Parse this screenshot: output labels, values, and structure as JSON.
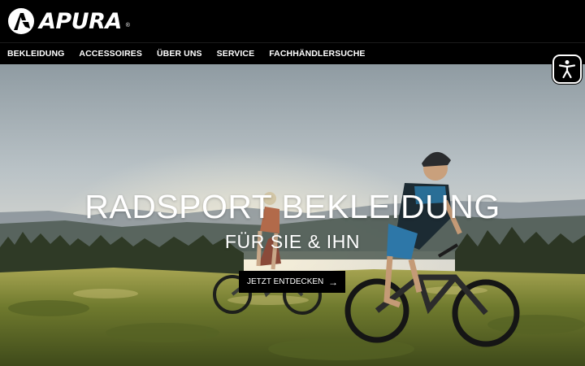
{
  "brand": {
    "name": "APURA",
    "registered_mark": "®"
  },
  "nav": {
    "items": [
      {
        "label": "BEKLEIDUNG"
      },
      {
        "label": "ACCESSOIRES"
      },
      {
        "label": "ÜBER UNS"
      },
      {
        "label": "SERVICE"
      },
      {
        "label": "FACHHÄNDLERSUCHE"
      }
    ]
  },
  "hero": {
    "headline": "RADSPORT BEKLEIDUNG",
    "subline": "FÜR SIE & IHN",
    "cta_label": "JETZT ENTDECKEN",
    "cta_icon": "arrow-right-icon",
    "image_subject": "two mountain bikers on e-bikes in a meadow"
  },
  "accessibility": {
    "icon": "accessibility-person-icon"
  },
  "colors": {
    "header_bg": "#000000",
    "nav_text": "#ffffff",
    "cta_bg": "#000000",
    "meadow": "#6b7a2e",
    "sky": "#c8cfd0"
  }
}
